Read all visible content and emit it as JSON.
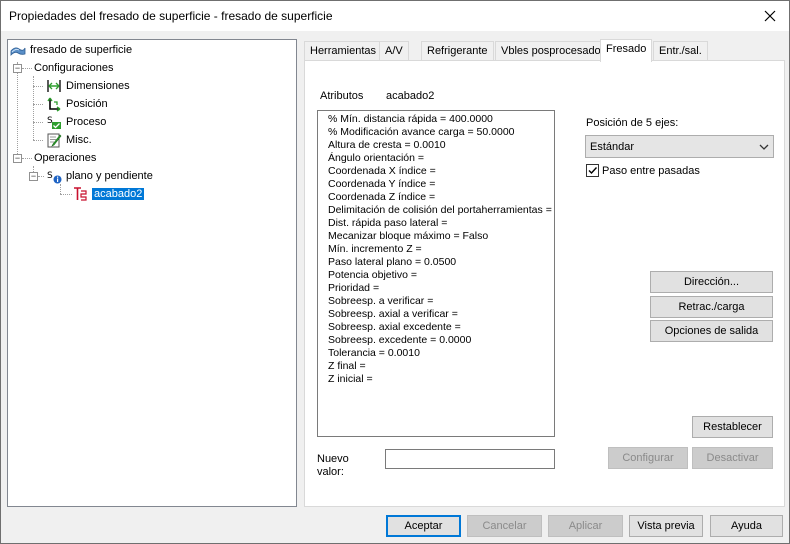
{
  "window": {
    "title": "Propiedades del fresado de superficie - fresado de superficie"
  },
  "tree": {
    "root": "fresado de superficie",
    "configuraciones": "Configuraciones",
    "dimensiones": "Dimensiones",
    "posicion": "Posición",
    "proceso": "Proceso",
    "misc": "Misc.",
    "operaciones": "Operaciones",
    "plano": "plano y pendiente",
    "acabado": "acabado2"
  },
  "tabs": [
    "Herramientas",
    "A/V",
    "Refrigerante",
    "Vbles posprocesado",
    "Fresado",
    "Entr./sal."
  ],
  "active_tab": "Fresado",
  "attributes": {
    "label": "Atributos",
    "name": "acabado2",
    "lines": [
      "% Mín. distancia rápida = 400.0000",
      "% Modificación avance carga = 50.0000",
      "Altura de cresta = 0.0010",
      "Ángulo orientación =",
      "Coordenada X índice =",
      "Coordenada Y índice =",
      "Coordenada Z índice =",
      "Delimitación de colisión del portaherramientas =",
      "Dist. rápida paso lateral =",
      "Mecanizar bloque máximo = Falso",
      "Mín. incremento Z =",
      "Paso lateral plano = 0.0500",
      "Potencia objetivo  =",
      "Prioridad =",
      "Sobreesp. a verificar =",
      "Sobreesp. axial a verificar =",
      "Sobreesp. axial excedente =",
      "Sobreesp. excedente = 0.0000",
      "Tolerancia = 0.0010",
      "Z final =",
      "Z inicial ="
    ]
  },
  "new_value": {
    "label_line1": "Nuevo",
    "label_line2": "valor:",
    "value": ""
  },
  "five_axis": {
    "label": "Posición de 5 ejes:",
    "selected": "Estándar"
  },
  "between_passes": {
    "label": "Paso entre pasadas",
    "checked": true
  },
  "side_buttons": {
    "direccion": "Dirección...",
    "retrac": "Retrac./carga",
    "opciones": "Opciones de salida",
    "restablecer": "Restablecer",
    "configurar": "Configurar",
    "desactivar": "Desactivar"
  },
  "footer": {
    "aceptar": "Aceptar",
    "cancelar": "Cancelar",
    "aplicar": "Aplicar",
    "vista_previa": "Vista previa",
    "ayuda": "Ayuda"
  },
  "colors": {
    "selection": "#0078d7",
    "accent_green": "#2e9e2e",
    "accent_red": "#c8102e"
  }
}
